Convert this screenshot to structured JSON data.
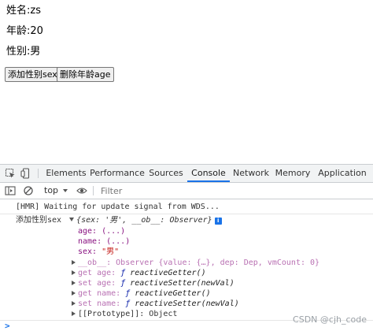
{
  "page": {
    "name_line": "姓名:zs",
    "age_line": "年龄:20",
    "sex_line": "性别:男",
    "add_sex_button": "添加性别sex",
    "delete_age_button": "删除年龄age"
  },
  "devtools": {
    "tabs": [
      "Elements",
      "Performance",
      "Sources",
      "Console",
      "Network",
      "Memory",
      "Application"
    ],
    "active_tab": "Console",
    "context": "top",
    "filter_placeholder": "Filter",
    "accent": "#1a73e8"
  },
  "console": {
    "hmr_message": "[HMR] Waiting for update signal from WDS...",
    "log_label": "添加性别sex",
    "object_summary": "{sex: '男', __ob__: Observer}",
    "props": {
      "age": "age: (...)",
      "name": "name: (...)",
      "sex_key": "sex:",
      "sex_value": "\"男\""
    },
    "ob_line": "__ob__: Observer {value: {…}, dep: Dep, vmCount: 0}",
    "accessors": [
      {
        "prefix": "get age:",
        "fn": "reactiveGetter()"
      },
      {
        "prefix": "set age:",
        "fn": "reactiveSetter(newVal)"
      },
      {
        "prefix": "get name:",
        "fn": "reactiveGetter()"
      },
      {
        "prefix": "set name:",
        "fn": "reactiveSetter(newVal)"
      }
    ],
    "prototype_line": "[[Prototype]]: Object",
    "prompt_symbol": ">"
  },
  "watermark": "CSDN @cjh_code"
}
